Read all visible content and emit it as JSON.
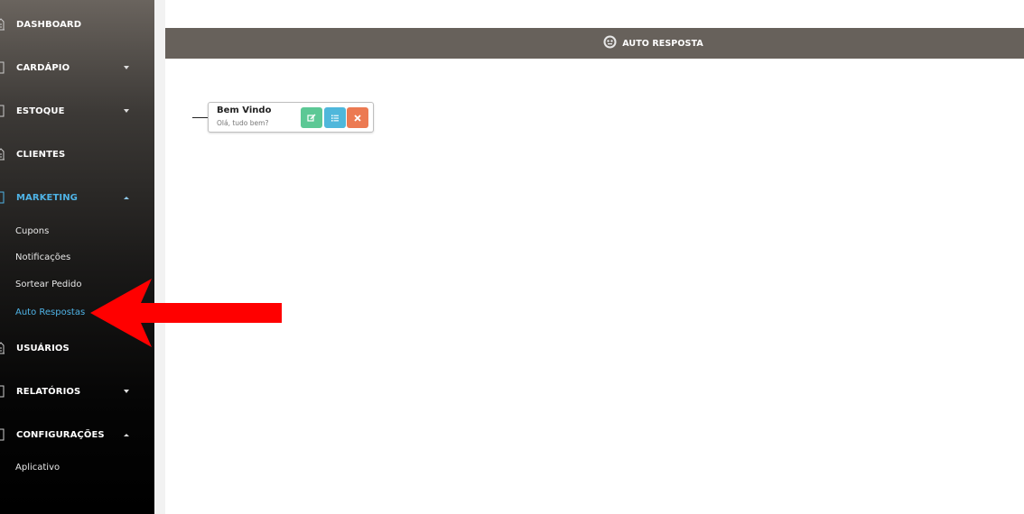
{
  "sidebar": {
    "items": [
      {
        "label": "DASHBOARD",
        "icon": "building-icon"
      },
      {
        "label": "CARDÁPIO",
        "icon": "menu-book-icon"
      },
      {
        "label": "ESTOQUE",
        "icon": "box-icon"
      },
      {
        "label": "CLIENTES",
        "icon": "building-icon"
      },
      {
        "label": "MARKETING",
        "icon": "marketing-icon",
        "active": true
      },
      {
        "label": "USUÁRIOS",
        "icon": "building-icon"
      },
      {
        "label": "RELATÓRIOS",
        "icon": "report-icon"
      },
      {
        "label": "CONFIGURAÇÕES",
        "icon": "settings-icon"
      }
    ],
    "marketing_sub": [
      "Cupons",
      "Notificações",
      "Sortear Pedido",
      "Auto Respostas"
    ],
    "config_sub": [
      "Aplicativo"
    ],
    "active_color": "#4fb3e6"
  },
  "annotation": {
    "arrow_color": "#ff0000"
  },
  "header": {
    "title": "AUTO RESPOSTA",
    "icon": "robot-icon",
    "bg_color": "#67615b"
  },
  "card": {
    "title": "Bem Vindo",
    "subtitle": "Olá, tudo bem?",
    "buttons": [
      {
        "name": "edit",
        "icon": "edit-icon",
        "color": "#5cc895"
      },
      {
        "name": "list",
        "icon": "list-icon",
        "color": "#4fb7db"
      },
      {
        "name": "delete",
        "icon": "close-icon",
        "color": "#ec7a52"
      }
    ]
  }
}
